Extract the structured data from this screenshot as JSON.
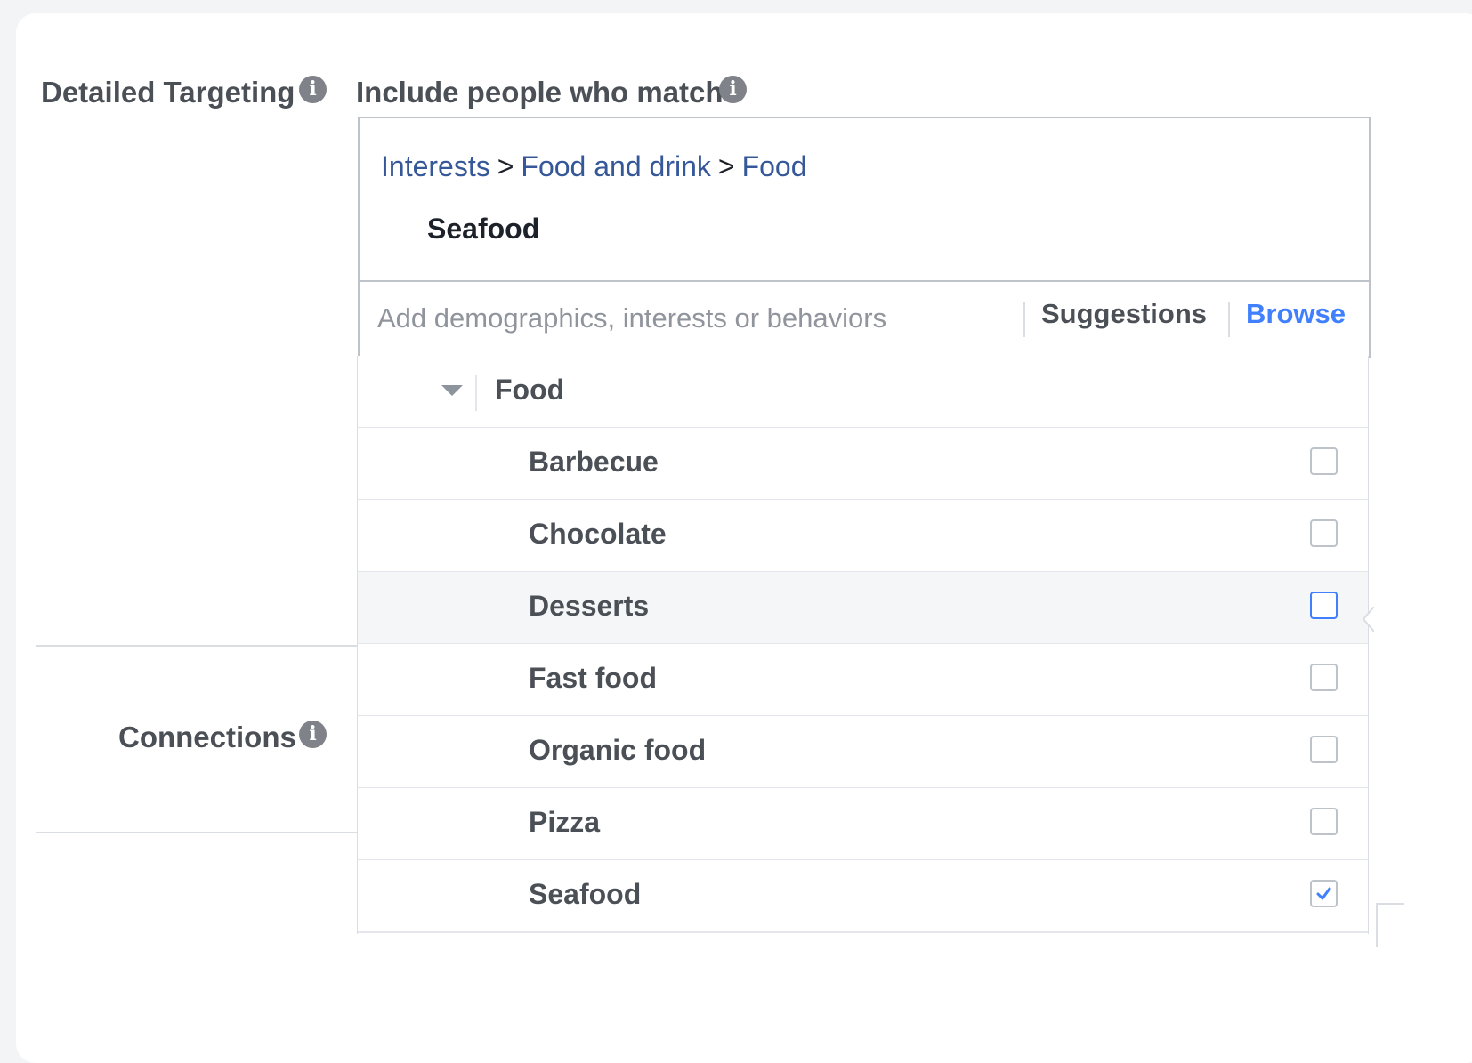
{
  "labels": {
    "detailed_targeting": "Detailed Targeting",
    "include_people": "Include people who match",
    "connections": "Connections",
    "info_glyph": "i"
  },
  "selection": {
    "breadcrumb": [
      "Interests",
      "Food and drink",
      "Food"
    ],
    "separator": ">",
    "selected_item": "Seafood"
  },
  "search": {
    "placeholder": "Add demographics, interests or behaviors",
    "value": "",
    "suggestions_label": "Suggestions",
    "browse_label": "Browse"
  },
  "dropdown": {
    "category": "Food",
    "items": [
      {
        "label": "Barbecue",
        "checked": false
      },
      {
        "label": "Chocolate",
        "checked": false
      },
      {
        "label": "Desserts",
        "checked": false,
        "hovered": true
      },
      {
        "label": "Fast food",
        "checked": false
      },
      {
        "label": "Organic food",
        "checked": false
      },
      {
        "label": "Pizza",
        "checked": false
      },
      {
        "label": "Seafood",
        "checked": true
      }
    ]
  },
  "colors": {
    "link": "#365899",
    "accent": "#4080ff",
    "label_text": "#4b4f56"
  }
}
